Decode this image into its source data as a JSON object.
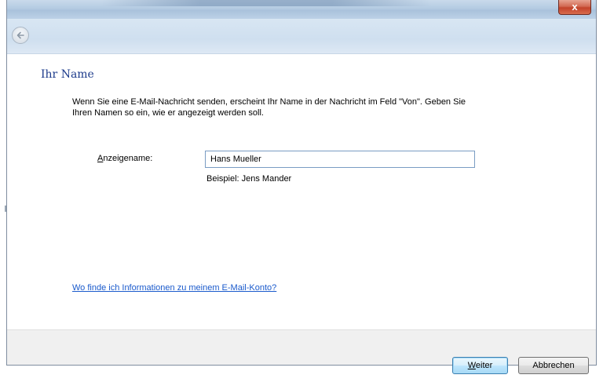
{
  "window": {
    "close_label": "x"
  },
  "page": {
    "heading": "Ihr Name",
    "description": "Wenn Sie eine E-Mail-Nachricht senden, erscheint Ihr Name in der Nachricht im Feld \"Von\". Geben Sie Ihren Namen so ein, wie er angezeigt werden soll."
  },
  "form": {
    "display_name_label_accesskey": "A",
    "display_name_label_rest": "nzeigename:",
    "display_name_value": "Hans Mueller",
    "example_text": "Beispiel: Jens Mander"
  },
  "links": {
    "account_info": "Wo finde ich Informationen zu meinem E-Mail-Konto?"
  },
  "buttons": {
    "next_accesskey": "W",
    "next_rest": "eiter",
    "cancel_label": "Abbrechen"
  },
  "icons": {
    "back": "back-arrow-icon",
    "close": "close-icon"
  },
  "colors": {
    "heading": "#1e3c8c",
    "link": "#1a5acc",
    "close_button": "#c3432a"
  }
}
